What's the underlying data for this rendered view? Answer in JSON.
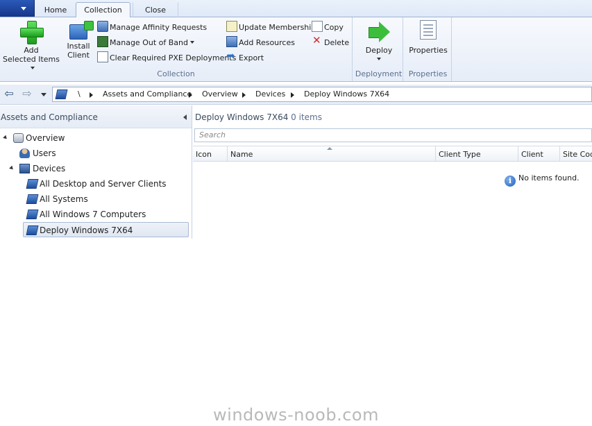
{
  "ribbon": {
    "tabs": [
      {
        "label": "Home"
      },
      {
        "label": "Collection",
        "active": true
      },
      {
        "label": "Close"
      }
    ],
    "groups": {
      "collection": {
        "label": "Collection",
        "add_selected_items": {
          "line1": "Add",
          "line2": "Selected Items",
          "icon": "plus-icon"
        },
        "install_client": {
          "line1": "Install",
          "line2": "Client",
          "icon": "install-client-icon"
        },
        "manage_affinity_requests": "Manage Affinity Requests",
        "manage_out_of_band": "Manage Out of Band",
        "clear_pxe": "Clear Required PXE Deployments",
        "update_membership": "Update Membership",
        "add_resources": "Add Resources",
        "export": "Export",
        "copy": "Copy",
        "delete": "Delete"
      },
      "deployment": {
        "label": "Deployment",
        "deploy": "Deploy"
      },
      "properties": {
        "label": "Properties",
        "properties": "Properties"
      }
    }
  },
  "address_bar": {
    "crumbs": [
      "\\",
      "Assets and Compliance",
      "Overview",
      "Devices",
      "Deploy Windows 7X64"
    ]
  },
  "nav_pane": {
    "title": "Assets and Compliance",
    "tree": [
      {
        "label": "Overview",
        "icon": "overview-icon"
      },
      {
        "label": "Users",
        "icon": "users-icon"
      },
      {
        "label": "Devices",
        "icon": "devices-icon"
      },
      {
        "label": "All Desktop and Server Clients",
        "icon": "collection-icon"
      },
      {
        "label": "All Systems",
        "icon": "collection-icon"
      },
      {
        "label": "All Windows 7 Computers",
        "icon": "collection-icon"
      },
      {
        "label": "Deploy Windows 7X64",
        "icon": "collection-icon",
        "selected": true
      }
    ]
  },
  "main": {
    "title": "Deploy Windows 7X64",
    "count": "0 items",
    "search_placeholder": "Search",
    "columns": [
      "Icon",
      "Name",
      "Client Type",
      "Client",
      "Site Code"
    ],
    "empty_message": "No items found."
  },
  "watermark": "windows-noob.com",
  "colors": {
    "app_menu": "#17358a",
    "ribbon_bg": "#e6edf8",
    "group_label": "#5a6f8e",
    "selected_item_border": "#a9bad3"
  }
}
